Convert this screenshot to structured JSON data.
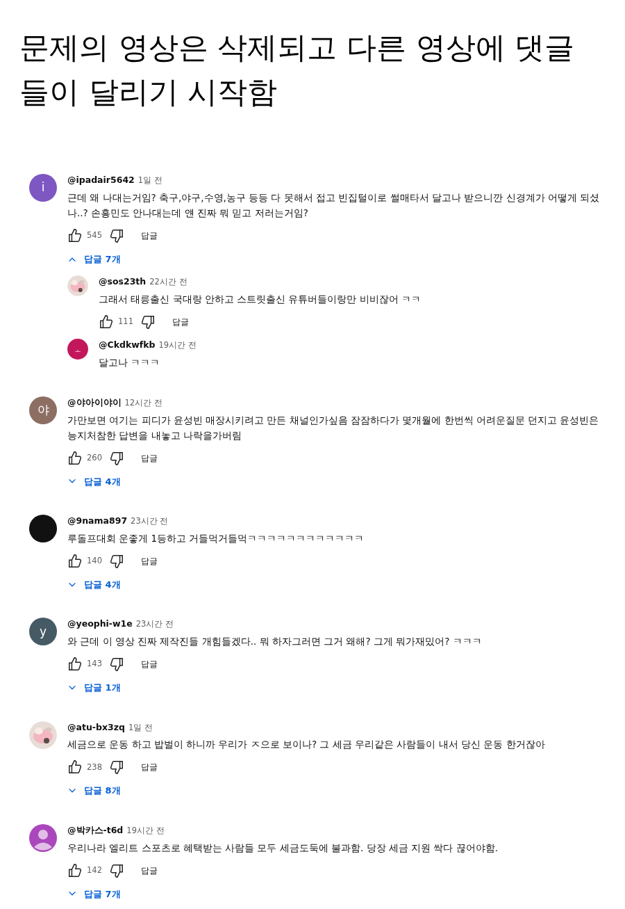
{
  "caption": "문제의 영상은 삭제되고 다른 영상에 댓글들이 달리기 시작함",
  "comments": [
    {
      "avatar": {
        "kind": "letter",
        "letter": "i",
        "color": "#7e57c2"
      },
      "author": "@ipadair5642",
      "time": "1일 전",
      "text": "근데 왜 나대는거임? 축구,야구,수영,농구 등등 다 못해서 접고 빈집털이로 썰매타서 달고나 받으니깐 신경계가 어떻게 되셨나..? 손흥민도 안나대는데 얜 진짜 뭐 믿고 저러는거임?",
      "likes": "545",
      "reply_label": "답글",
      "replies_toggle": {
        "label": "답글 7개",
        "expanded": true
      },
      "replies": [
        {
          "author": "@sos23th",
          "time": "22시간 전",
          "text": "그래서 태릉출신 국대랑 안하고 스트릿출신 유튜버들이랑만 비비잖어 ㅋㅋ",
          "likes": "111",
          "reply_label": "답글"
        },
        {
          "avatar": {
            "kind": "letter",
            "letter": "ㅗ",
            "color": "#c2185b"
          },
          "author": "@Ckdkwfkb",
          "time": "19시간 전",
          "text": "달고나 ㅋㅋㅋ"
        }
      ]
    },
    {
      "avatar": {
        "kind": "letter",
        "letter": "야",
        "color": "#8d6e63"
      },
      "author": "@야아이야이",
      "time": "12시간 전",
      "text": "가만보면 여기는 피디가 윤성빈 매장시키려고 만든 채널인가싶음 잠잠하다가 몇개월에 한번씩 어려운질문 던지고 윤성빈은 능지처참한 답변을 내놓고 나락을가버림",
      "likes": "260",
      "reply_label": "답글",
      "replies_toggle": {
        "label": "답글 4개",
        "expanded": false
      }
    },
    {
      "avatar": {
        "kind": "plain",
        "color": "#111111"
      },
      "author": "@9nama897",
      "time": "23시간 전",
      "text": "루돌프대회 운좋게 1등하고 거들먹거들먹ㅋㅋㅋㅋㅋㅋㅋㅋㅋㅋㅋㅋ",
      "likes": "140",
      "reply_label": "답글",
      "replies_toggle": {
        "label": "답글 4개",
        "expanded": false
      }
    },
    {
      "avatar": {
        "kind": "letter",
        "letter": "y",
        "color": "#455a64"
      },
      "author": "@yeophi-w1e",
      "time": "23시간 전",
      "text": "와 근데 이 영상 진짜 제작진들 개힘들겠다.. 뭐 하자그러면 그거 왜해? 그게 뭐가재밌어? ㅋㅋㅋ",
      "likes": "143",
      "reply_label": "답글",
      "replies_toggle": {
        "label": "답글 1개",
        "expanded": false
      }
    },
    {
      "author": "@atu-bx3zq",
      "time": "1일 전",
      "text": "세금으로 운동 하고 밥벌이 하니까 우리가 ㅈ으로 보이나? 그 세금 우리같은 사람들이 내서 당신 운동 한거잖아",
      "likes": "238",
      "reply_label": "답글",
      "replies_toggle": {
        "label": "답글 8개",
        "expanded": false
      }
    },
    {
      "avatar": {
        "kind": "person",
        "color": "#ab47bc"
      },
      "author": "@박카스-t6d",
      "time": "19시간 전",
      "text": "우리나라 엘리트 스포츠로 혜택받는 사람들  모두 세금도둑에 불과함. 당장 세금 지원 싹다 끊어야함.",
      "likes": "142",
      "reply_label": "답글",
      "replies_toggle": {
        "label": "답글 7개",
        "expanded": false
      }
    }
  ]
}
